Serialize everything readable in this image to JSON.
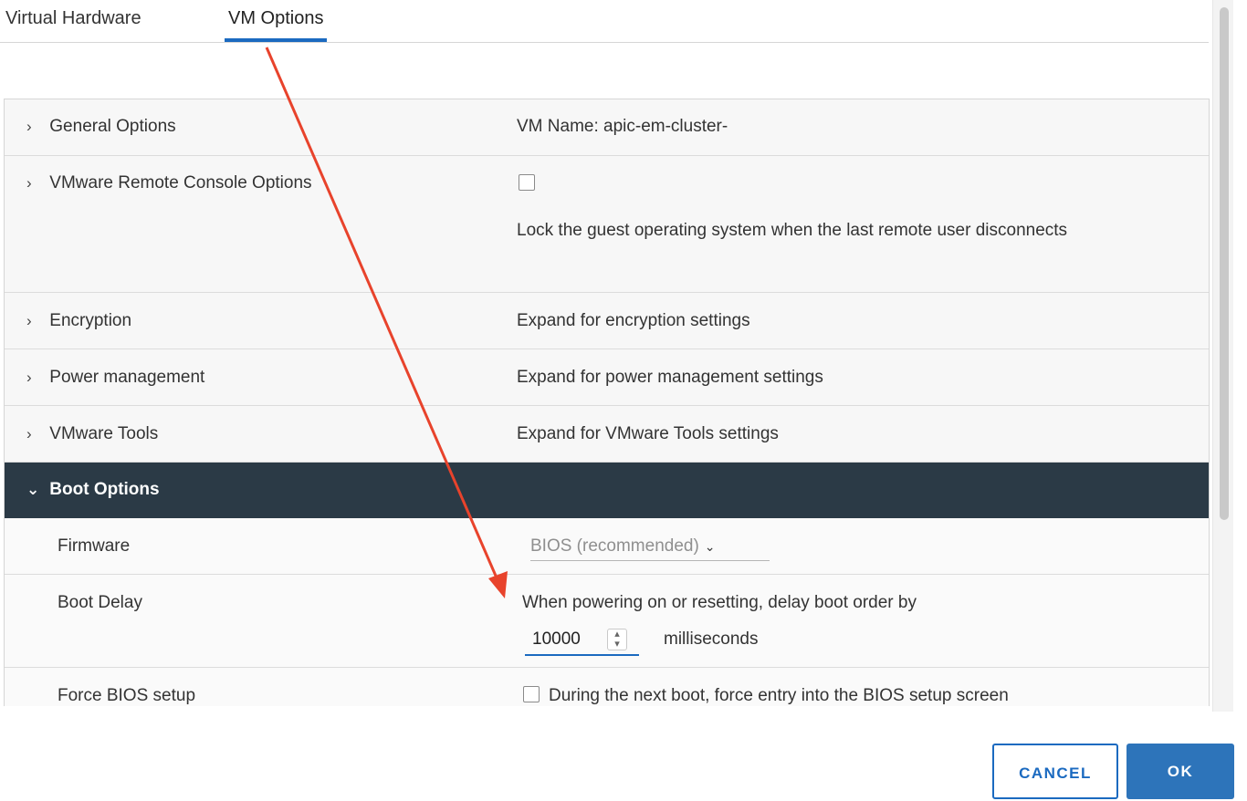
{
  "tabs": [
    "Virtual Hardware",
    "VM Options"
  ],
  "rows": {
    "general": {
      "label": "General Options",
      "value": "VM Name: apic-em-cluster-"
    },
    "remote_console": {
      "label": "VMware Remote Console Options",
      "value": "Lock the guest operating system when the last remote user disconnects"
    },
    "encryption": {
      "label": "Encryption",
      "value": "Expand for encryption settings"
    },
    "power": {
      "label": "Power management",
      "value": "Expand for power management settings"
    },
    "tools": {
      "label": "VMware Tools",
      "value": "Expand for VMware Tools settings"
    },
    "boot": {
      "label": "Boot Options"
    },
    "firmware": {
      "label": "Firmware",
      "value": "BIOS (recommended)"
    },
    "boot_delay": {
      "label": "Boot Delay",
      "value": "When powering on or resetting, delay boot order by",
      "input_value": "10000",
      "unit": "milliseconds"
    },
    "force_bios": {
      "label": "Force BIOS setup",
      "value": "During the next boot, force entry into the BIOS setup screen"
    }
  },
  "icons": {
    "collapsed": "chevron-right-icon",
    "expanded": "chevron-down-icon",
    "dropdown": "chevron-down-icon",
    "spinner": "spinner-icon",
    "annotation": "red-arrow"
  },
  "buttons": {
    "cancel": "CANCEL",
    "ok": "OK"
  },
  "colors": {
    "accent": "#1b6ac0",
    "header_dark": "#2b3a46",
    "annotation": "#e8432c"
  }
}
